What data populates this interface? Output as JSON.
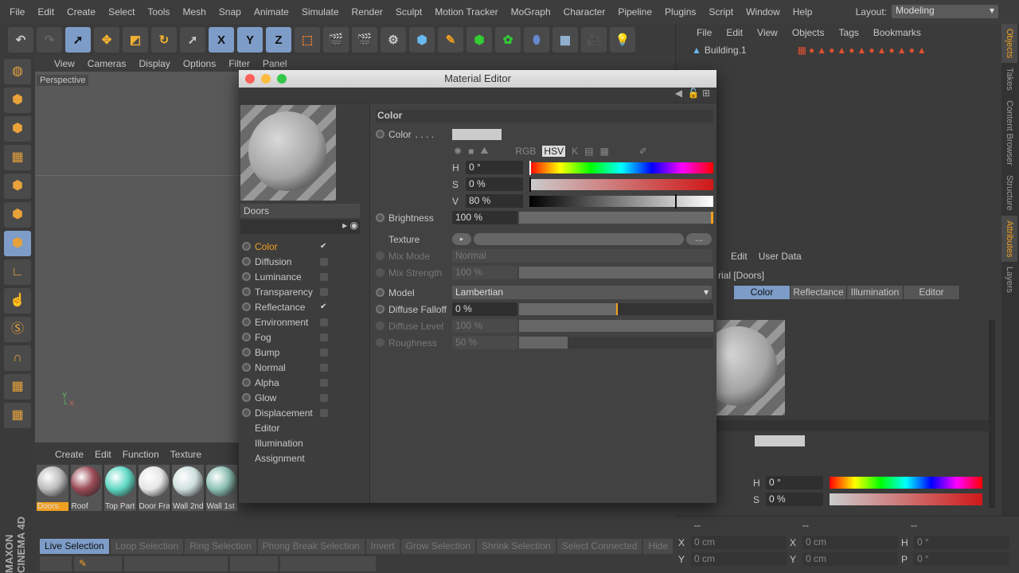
{
  "menu": [
    "File",
    "Edit",
    "Create",
    "Select",
    "Tools",
    "Mesh",
    "Snap",
    "Animate",
    "Simulate",
    "Render",
    "Sculpt",
    "Motion Tracker",
    "MoGraph",
    "Character",
    "Pipeline",
    "Plugins",
    "Script",
    "Window",
    "Help"
  ],
  "layout": {
    "label": "Layout:",
    "value": "Modeling"
  },
  "toolbar": [
    "undo-icon",
    "redo-icon",
    "live-select-icon",
    "move-icon",
    "scale-icon",
    "rotate-icon",
    "recent-tool-icon",
    "x-axis-icon",
    "y-axis-icon",
    "z-axis-icon",
    "coordinate-system-icon",
    "render-view-icon",
    "render-picture-viewer-icon",
    "render-settings-icon",
    "cube-icon",
    "pen-icon",
    "subdivision-icon",
    "cloner-icon",
    "deformer-icon",
    "floor-icon",
    "camera-icon",
    "light-icon"
  ],
  "axis_labels": [
    "X",
    "Y",
    "Z"
  ],
  "viewport": {
    "menu": [
      "View",
      "Cameras",
      "Display",
      "Options",
      "Filter",
      "Panel"
    ],
    "label": "Perspective"
  },
  "material_manager": {
    "menu": [
      "Create",
      "Edit",
      "Function",
      "Texture"
    ],
    "materials": [
      {
        "name": "Doors",
        "color": "#bcbcbc",
        "selected": true
      },
      {
        "name": "Roof",
        "color": "#9a4a55"
      },
      {
        "name": "Top Part",
        "color": "#5fd8c4"
      },
      {
        "name": "Door Frame",
        "color": "#e6e6e6"
      },
      {
        "name": "Wall 2nd",
        "color": "#cfe0de"
      },
      {
        "name": "Wall 1st",
        "color": "#8fc4b6"
      }
    ]
  },
  "material_editor": {
    "title": "Material Editor",
    "material_name": "Doors",
    "channels": [
      {
        "label": "Color",
        "checked": true,
        "active": true
      },
      {
        "label": "Diffusion"
      },
      {
        "label": "Luminance"
      },
      {
        "label": "Transparency"
      },
      {
        "label": "Reflectance",
        "checked": true
      },
      {
        "label": "Environment"
      },
      {
        "label": "Fog"
      },
      {
        "label": "Bump"
      },
      {
        "label": "Normal"
      },
      {
        "label": "Alpha"
      },
      {
        "label": "Glow"
      },
      {
        "label": "Displacement"
      },
      {
        "label": "Editor"
      },
      {
        "label": "Illumination"
      },
      {
        "label": "Assignment"
      }
    ],
    "section": "Color",
    "color_label": "Color",
    "color_swatch": "#cccccc",
    "modes": [
      "RGB",
      "HSV",
      "K"
    ],
    "h": {
      "label": "H",
      "value": "0 °",
      "fraction": 0
    },
    "s": {
      "label": "S",
      "value": "0 %",
      "fraction": 0
    },
    "v": {
      "label": "V",
      "value": "80 %",
      "fraction": 0.8
    },
    "brightness": {
      "label": "Brightness",
      "value": "100 %"
    },
    "texture": {
      "label": "Texture",
      "more": "..."
    },
    "mix_mode": {
      "label": "Mix Mode",
      "value": "Normal"
    },
    "mix_strength": {
      "label": "Mix Strength",
      "value": "100 %"
    },
    "model": {
      "label": "Model",
      "value": "Lambertian"
    },
    "diffuse_falloff": {
      "label": "Diffuse Falloff",
      "value": "0 %"
    },
    "diffuse_level": {
      "label": "Diffuse Level",
      "value": "100 %"
    },
    "roughness": {
      "label": "Roughness",
      "value": "50 %"
    }
  },
  "objects": {
    "menu": [
      "File",
      "Edit",
      "View",
      "Objects",
      "Tags",
      "Bookmarks"
    ],
    "item": "Building.1"
  },
  "attributes": {
    "menu": [
      "Edit",
      "User Data"
    ],
    "title": "rial [Doors]",
    "tabs": [
      "Color",
      "Reflectance",
      "Illumination",
      "Editor"
    ],
    "h": "0 °",
    "s": "0 %"
  },
  "right_tabs": [
    "Objects",
    "Takes",
    "Content Browser",
    "Structure",
    "Attributes",
    "Layers"
  ],
  "coords": {
    "headers": [
      "--",
      "--",
      "--"
    ],
    "rows": [
      [
        "X",
        "0 cm",
        "X",
        "0 cm",
        "H",
        "0 °"
      ],
      [
        "Y",
        "0 cm",
        "Y",
        "0 cm",
        "P",
        "0 °"
      ]
    ]
  },
  "selection_bar": [
    "Live Selection",
    "Loop Selection",
    "Ring Selection",
    "Phong Break Selection",
    "Invert",
    "Grow Selection",
    "Shrink Selection",
    "Select Connected",
    "Hide"
  ],
  "logo": "MAXON CINEMA 4D",
  "accent": "#7d9cc8",
  "highlight": "#f0a020"
}
